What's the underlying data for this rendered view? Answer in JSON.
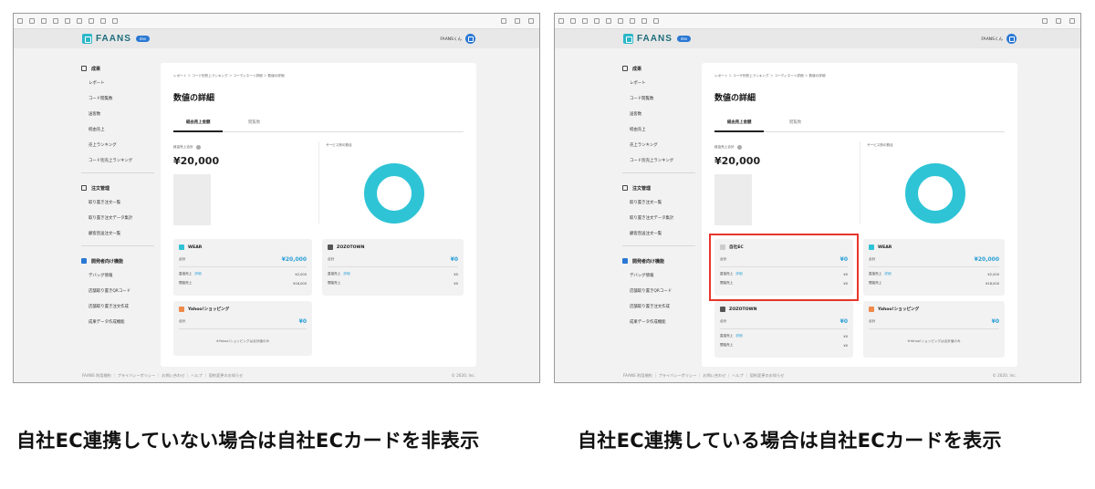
{
  "toolbar_icons": [
    "resize-icon",
    "zoom-in-icon",
    "zoom-out-icon",
    "rotate-icon",
    "grid-icon",
    "calendar-icon",
    "copy-icon",
    "print-icon",
    "frame-icon"
  ],
  "toolbar_right_icons": [
    "expand-icon",
    "external-link-icon",
    "link-icon"
  ],
  "app": {
    "logo": "FAANS",
    "badge": "dev",
    "user": "FAANSくん"
  },
  "sidebar": {
    "sections": [
      {
        "title": "成果",
        "icon": "chart-icon",
        "items": [
          "レポート",
          "コード閲覧数",
          "送客数",
          "経由売上",
          "売上ランキング",
          "コード別売上ランキング"
        ]
      },
      {
        "title": "注文管理",
        "icon": "order-icon",
        "items": [
          "取り置き注文一覧",
          "取り置き注文データ集計",
          "顧客直送注文一覧"
        ]
      },
      {
        "title": "開発者向け機能",
        "icon": "code-icon",
        "items": [
          "デバッグ情報",
          "店舗取り置きQRコード",
          "店舗取り置き注文作成",
          "成果データ作成機能"
        ]
      }
    ]
  },
  "left": {
    "breadcrumb": "レポート ＞ コード別売上ランキング ＞ コーディネート詳細 ＞ 数値の詳細",
    "title": "数値の詳細",
    "tabs": [
      "経由売上金額",
      "閲覧数"
    ],
    "summary_label": "経由売上合計",
    "summary_value": "¥20,000",
    "donut_label": "サービス別の割合",
    "donut_color": "#2ec4d6",
    "cards": {
      "wear": {
        "name": "WEAR",
        "color": "#2ec4d6",
        "total_label": "合計",
        "total": "¥20,000",
        "row1_label": "直接売上",
        "link": "詳細",
        "row1": "¥2,000",
        "row2_label": "間接売上",
        "row2": "¥18,000"
      },
      "zozo": {
        "name": "ZOZOTOWN",
        "color": "#555555",
        "total_label": "合計",
        "total": "¥0",
        "row1_label": "直接売上",
        "link": "詳細",
        "row1": "¥0",
        "row2_label": "間接売上",
        "row2": "¥0"
      },
      "yahoo": {
        "name": "Yahoo!ショッピング",
        "color": "#f08a4b",
        "total_label": "合計",
        "total": "¥0",
        "note": "※Yahoo!ショッピングは合計値のみ"
      }
    }
  },
  "right": {
    "breadcrumb": "レポート ＞ ユーザ別売上ランキング ＞ コーディネート詳細 ＞ 数値の詳細",
    "title": "数値の詳細",
    "tabs": [
      "経由売上金額",
      "閲覧数"
    ],
    "summary_label": "経由売上合計",
    "summary_value": "¥20,000",
    "donut_label": "サービス別の割合",
    "donut_color": "#2ec4d6",
    "highlight_color": "#e8352b",
    "cards": {
      "own": {
        "name": "自社EC",
        "color": "#cccccc",
        "total_label": "合計",
        "total": "¥0",
        "row1_label": "直接売上",
        "link": "詳細",
        "row1": "¥0",
        "row2_label": "間接売上",
        "row2": "¥0"
      },
      "wear": {
        "name": "WEAR",
        "color": "#2ec4d6",
        "total_label": "合計",
        "total": "¥20,000",
        "row1_label": "直接売上",
        "link": "詳細",
        "row1": "¥2,000",
        "row2_label": "間接売上",
        "row2": "¥18,000"
      },
      "zozo": {
        "name": "ZOZOTOWN",
        "color": "#555555",
        "total_label": "合計",
        "total": "¥0",
        "row1_label": "直接売上",
        "link": "詳細",
        "row1": "¥0",
        "row2_label": "間接売上",
        "row2": "¥0"
      },
      "yahoo": {
        "name": "Yahoo!ショッピング",
        "color": "#f08a4b",
        "total_label": "合計",
        "total": "¥0",
        "note": "※Yahoo!ショッピングは合計値のみ"
      }
    }
  },
  "footer": {
    "links": [
      "FAANS 利用規約",
      "プライバシーポリシー",
      "お問い合わせ",
      "ヘルプ",
      "契約変更のお知らせ"
    ],
    "copyright": "© 2020, Inc."
  },
  "captions": {
    "left": "自社EC連携していない場合は自社ECカードを非表示",
    "right": "自社EC連携している場合は自社ECカードを表示"
  }
}
